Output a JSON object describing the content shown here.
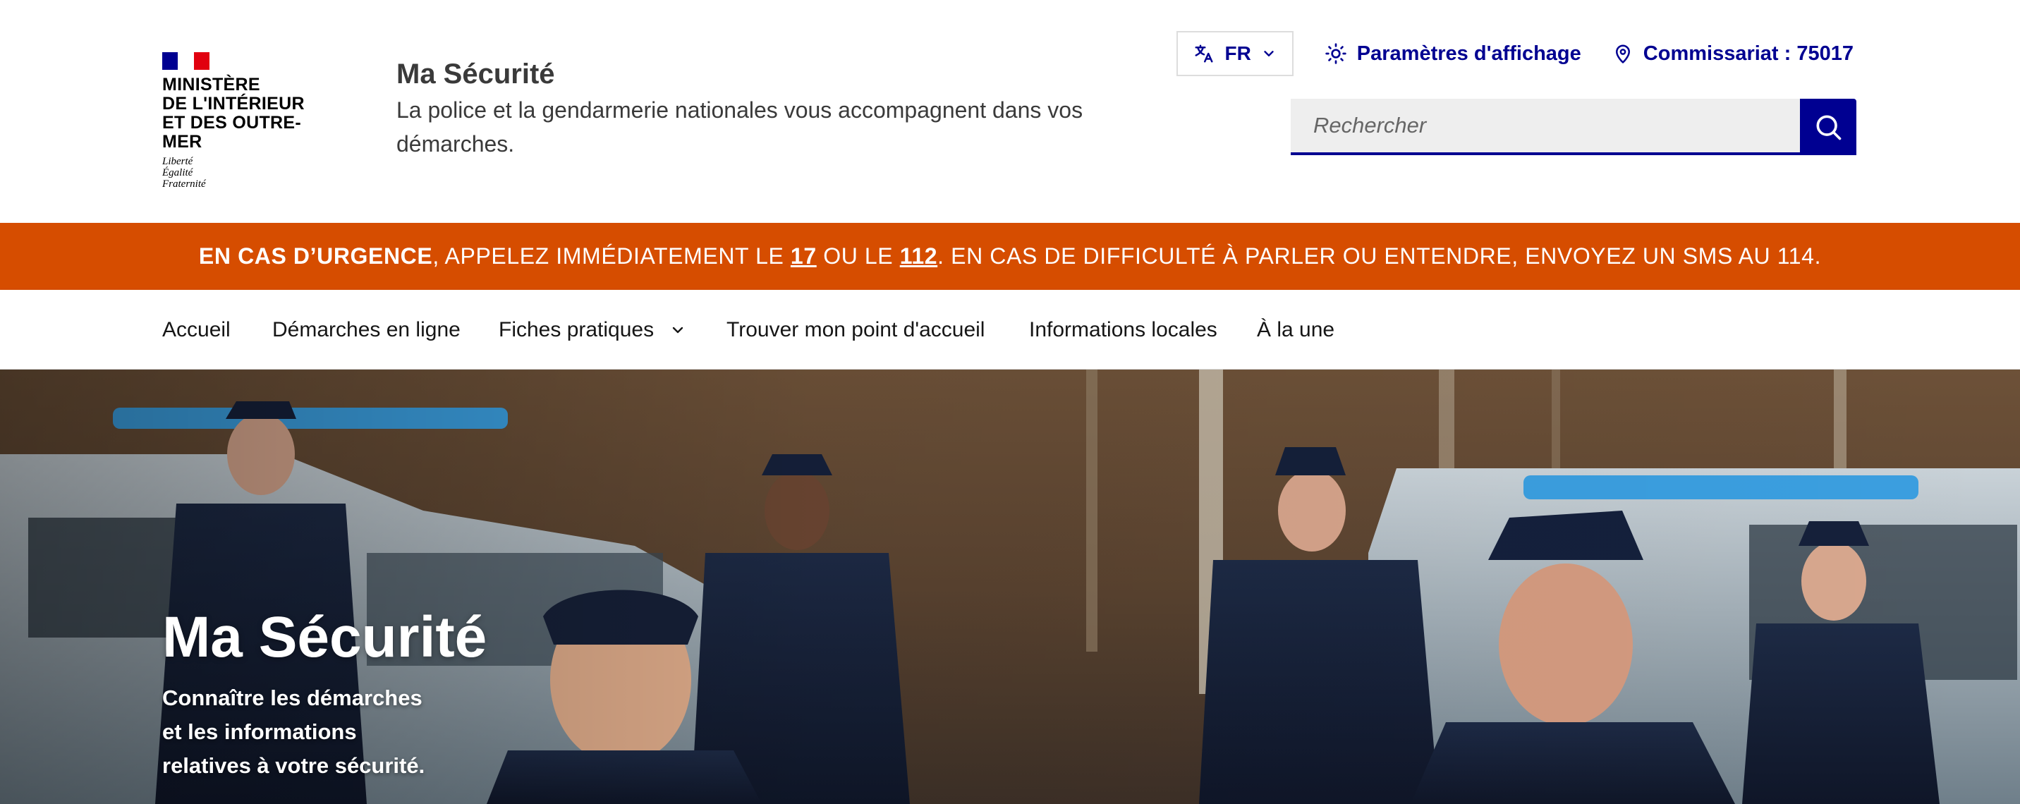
{
  "ministry": {
    "lines": [
      "MINISTÈRE",
      "DE L'INTÉRIEUR",
      "ET DES OUTRE-MER"
    ],
    "motto": [
      "Liberté",
      "Égalité",
      "Fraternité"
    ]
  },
  "site": {
    "title": "Ma Sécurité",
    "tagline": "La police et la gendarmerie nationales vous accompagnent dans vos démarches."
  },
  "tools": {
    "language": "FR",
    "display_settings": "Paramètres d'affichage",
    "commissariat": "Commissariat : 75017"
  },
  "search": {
    "placeholder": "Rechercher"
  },
  "alert": {
    "strong": "EN CAS D’URGENCE",
    "part1": ", APPELEZ IMMÉDIATEMENT LE ",
    "num1": "17",
    "part2": " OU LE ",
    "num2": "112",
    "part3": ". EN CAS DE DIFFICULTÉ À PARLER OU ENTENDRE, ENVOYEZ UN SMS AU 114."
  },
  "nav": {
    "items": [
      {
        "label": "Accueil"
      },
      {
        "label": "Démarches en ligne"
      },
      {
        "label": "Fiches pratiques"
      },
      {
        "label": "Trouver mon point d'accueil"
      },
      {
        "label": "Informations locales"
      },
      {
        "label": "À la une"
      }
    ]
  },
  "hero": {
    "title": "Ma Sécurité",
    "subtitle": [
      "Connaître les démarches",
      "et les informations",
      "relatives à votre sécurité."
    ]
  },
  "colors": {
    "brand_blue": "#000091",
    "alert_orange": "#d64d00",
    "flag_red": "#e1000f"
  }
}
